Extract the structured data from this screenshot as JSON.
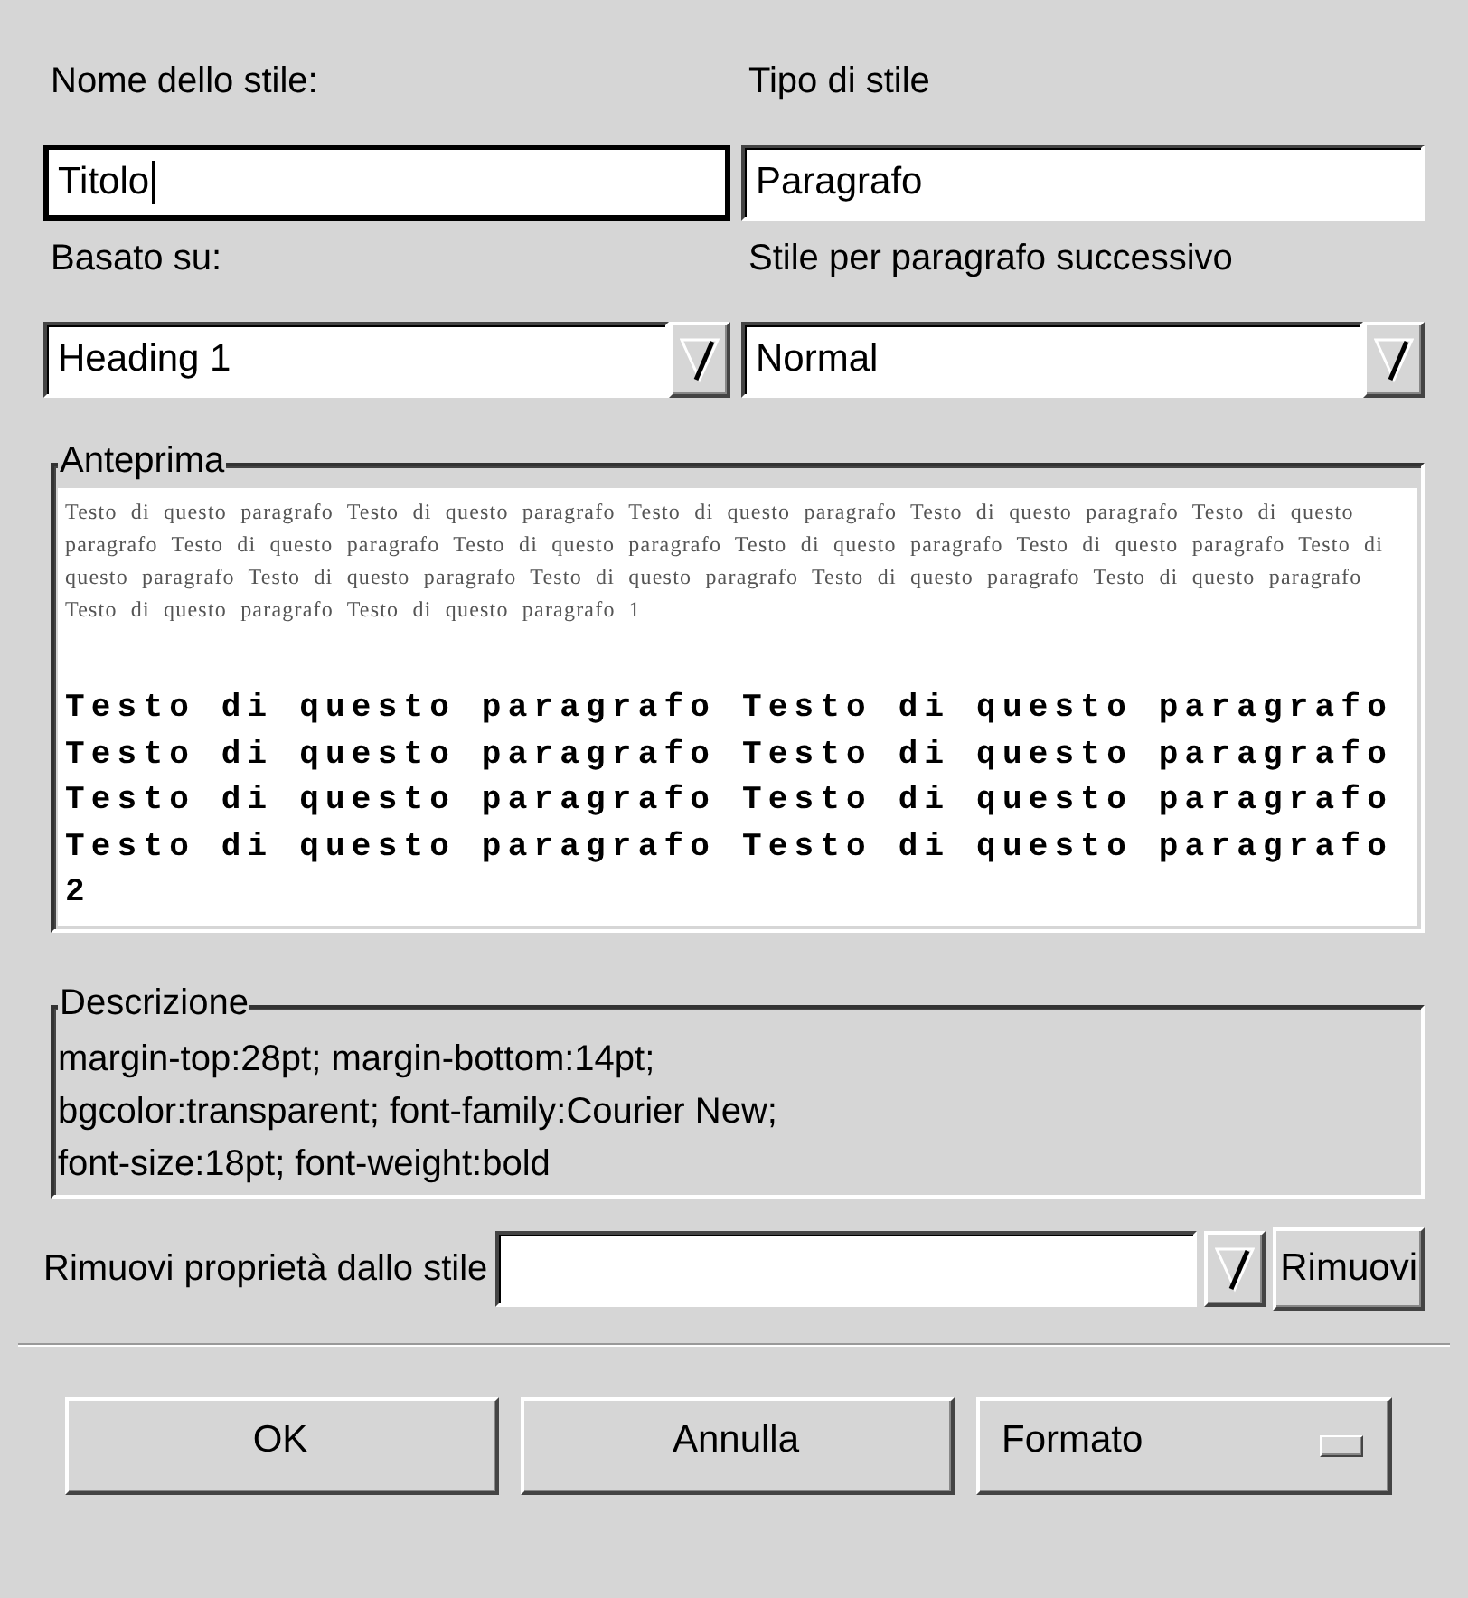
{
  "fields": [
    {
      "kind": "text",
      "label": "Nome dello stile:",
      "value": "Titolo",
      "focused": true
    },
    {
      "kind": "text",
      "label": "Tipo di stile",
      "value": "Paragrafo",
      "focused": false
    },
    {
      "kind": "combo",
      "label": "Basato su:",
      "value": "Heading 1",
      "focused": false
    },
    {
      "kind": "combo",
      "label": "Stile per paragrafo successivo",
      "value": "Normal",
      "focused": false
    }
  ],
  "preview": {
    "title": "Anteprima",
    "previous_paragraph": "Testo di questo paragrafo Testo di questo paragrafo Testo di questo paragrafo Testo di questo paragrafo Testo di questo paragrafo Testo di questo paragrafo Testo di questo paragrafo Testo di questo paragrafo Testo di questo paragrafo Testo di questo paragrafo Testo di questo paragrafo Testo di questo paragrafo Testo di questo paragrafo Testo di questo paragrafo Testo di questo paragrafo Testo di questo paragrafo 1",
    "current_paragraph": "Testo di questo paragrafo Testo di questo paragrafo Testo di questo paragrafo Testo di questo paragrafo Testo di questo paragrafo Testo di questo paragrafo Testo di questo paragrafo Testo di questo paragrafo 2"
  },
  "description": {
    "title": "Descrizione",
    "text": "margin-top:28pt; margin-bottom:14pt; bgcolor:transparent; font-family:Courier New; font-size:18pt; font-weight:bold"
  },
  "remove_property": {
    "label": "Rimuovi proprietà dallo stile",
    "button": "Rimuovi"
  },
  "buttons": [
    {
      "kind": "push",
      "label": "OK"
    },
    {
      "kind": "push",
      "label": "Annulla"
    },
    {
      "kind": "menu",
      "label": "Formato"
    }
  ]
}
